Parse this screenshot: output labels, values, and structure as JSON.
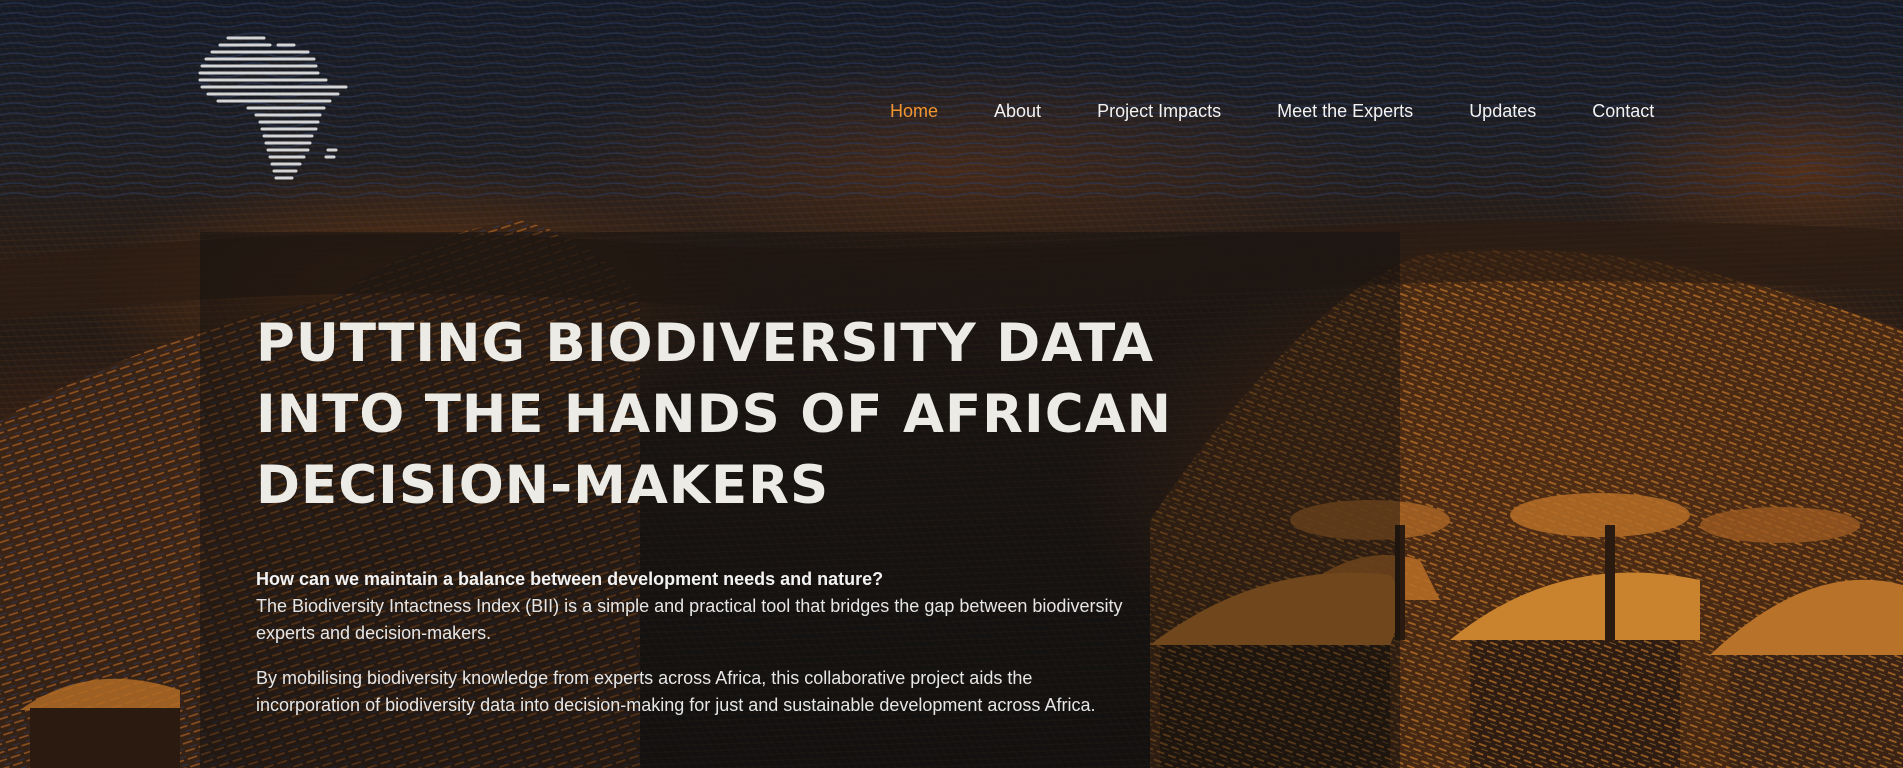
{
  "site": {
    "logo_name": "africa-map-logo"
  },
  "nav": {
    "items": [
      {
        "label": "Home",
        "active": true
      },
      {
        "label": "About",
        "active": false
      },
      {
        "label": "Project Impacts",
        "active": false
      },
      {
        "label": "Meet the Experts",
        "active": false
      },
      {
        "label": "Updates",
        "active": false
      },
      {
        "label": "Contact",
        "active": false
      }
    ],
    "active_color": "#f3962f",
    "text_color": "#f2f2f2"
  },
  "hero": {
    "headline_lines": [
      "PUTTING BIODIVERSITY DATA",
      "INTO THE HANDS OF AFRICAN",
      "DECISION-MAKERS"
    ],
    "question": "How can we maintain a balance between development needs and nature?",
    "paragraph_1": "The Biodiversity Intactness Index (BII) is a simple and practical tool that bridges the gap between biodiversity experts and decision-makers.",
    "paragraph_2": "By mobilising biodiversity knowledge from experts across Africa, this collaborative project aids the incorporation of biodiversity data into decision-making for just and sustainable development across Africa."
  }
}
